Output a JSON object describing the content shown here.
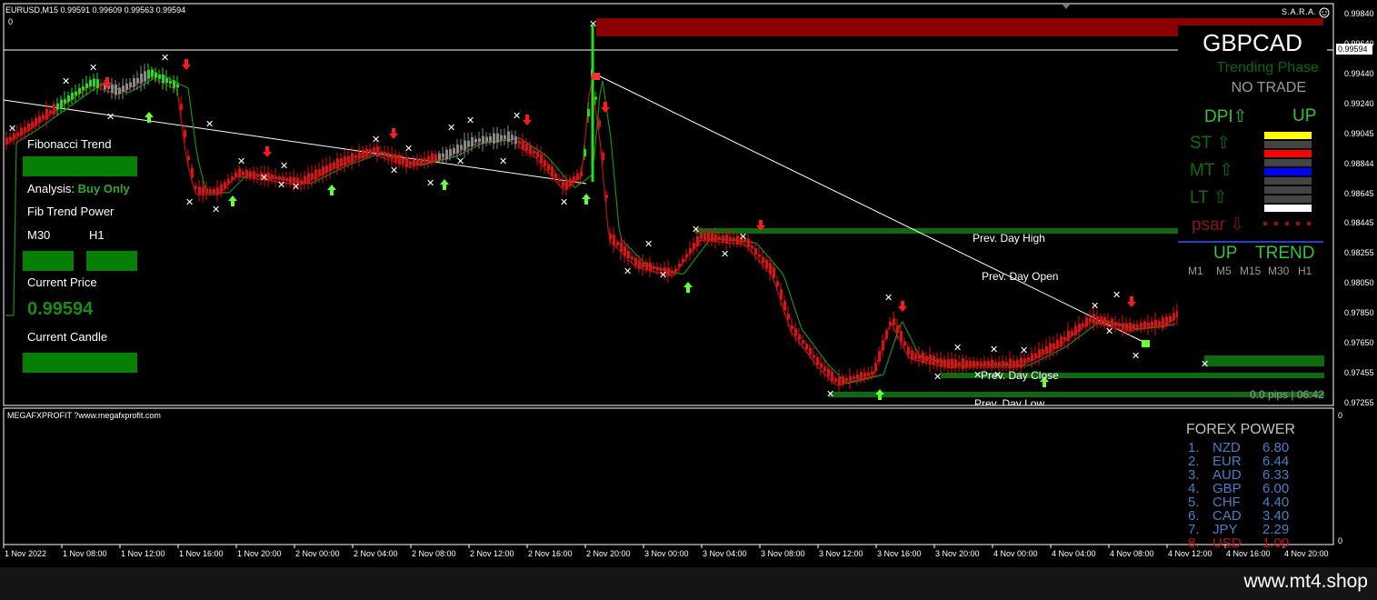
{
  "header": {
    "symbol_info": "EURUSD,M15  0.99591 0.99609 0.99563 0.99594",
    "zero": "0",
    "sara": "S.A.R.A."
  },
  "left_panel": {
    "fib_trend": "Fibonacci Trend",
    "analysis_label": "Analysis:",
    "analysis_value": "Buy Only",
    "fib_power": "Fib Trend Power",
    "m30": "M30",
    "h1": "H1",
    "current_price_label": "Current Price",
    "current_price": "0.99594",
    "current_candle": "Current Candle"
  },
  "right_panel": {
    "pair": "GBPCAD",
    "phase": "Trending Phase",
    "trade": "NO TRADE",
    "dpi": "DPI⇧",
    "dpi_dir": "UP",
    "st": "ST  ⇧",
    "mt": "MT  ⇧",
    "lt": "LT  ⇧",
    "psar": "psar ⇩",
    "up": "UP",
    "trend": "TREND",
    "timeframes": [
      "M1",
      "M5",
      "M15",
      "M30",
      "H1"
    ],
    "strength_colors": [
      "#ffff00",
      "#444444",
      "#ff0000",
      "#444444",
      "#0000ff",
      "#444444",
      "#444444",
      "#444444",
      "#ffffff"
    ]
  },
  "levels": {
    "prev_high": "Prev. Day High",
    "prev_open": "Prev. Day Open",
    "prev_close": "Prev. Day Close",
    "prev_low": "Prev. Day Low",
    "pips": "0.0 pips | 06:42"
  },
  "y_axis": [
    "0.99840",
    "0.99640",
    "0.99440",
    "0.99240",
    "0.99045",
    "0.98844",
    "0.98645",
    "0.98445",
    "0.98255",
    "0.98050",
    "0.97850",
    "0.97650",
    "0.97455",
    "0.97255"
  ],
  "current_price_tag": "0.99594",
  "x_axis": [
    "1 Nov 2022",
    "1 Nov 08:00",
    "1 Nov 12:00",
    "1 Nov 16:00",
    "1 Nov 20:00",
    "2 Nov 00:00",
    "2 Nov 04:00",
    "2 Nov 08:00",
    "2 Nov 12:00",
    "2 Nov 16:00",
    "2 Nov 20:00",
    "3 Nov 00:00",
    "3 Nov 04:00",
    "3 Nov 08:00",
    "3 Nov 12:00",
    "3 Nov 16:00",
    "3 Nov 20:00",
    "4 Nov 00:00",
    "4 Nov 04:00",
    "4 Nov 08:00",
    "4 Nov 12:00",
    "4 Nov 16:00",
    "4 Nov 20:00"
  ],
  "subwindow": {
    "title": "MEGAFXPROFIT ?www.megafxprofit.com",
    "y_top": "0",
    "y_bottom": "0",
    "forex_power_title": "FOREX POWER",
    "forex_power": [
      {
        "rank": "1.",
        "cur": "NZD",
        "val": "6.80"
      },
      {
        "rank": "2.",
        "cur": "EUR",
        "val": "6.44"
      },
      {
        "rank": "3.",
        "cur": "AUD",
        "val": "6.33"
      },
      {
        "rank": "4.",
        "cur": "GBP",
        "val": "6.00"
      },
      {
        "rank": "5.",
        "cur": "CHF",
        "val": "4.40"
      },
      {
        "rank": "6.",
        "cur": "CAD",
        "val": "3.40"
      },
      {
        "rank": "7.",
        "cur": "JPY",
        "val": "2.29"
      },
      {
        "rank": "8.",
        "cur": "USD",
        "val": "1.00"
      }
    ]
  },
  "footer": "www.mt4.shop"
}
